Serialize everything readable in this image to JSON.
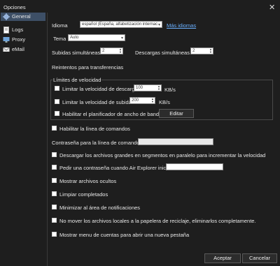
{
  "window": {
    "title": "Opciones",
    "close_icon": "close-icon"
  },
  "sidebar": {
    "items": [
      {
        "label": "General",
        "icon": "gear-icon",
        "selected": true
      },
      {
        "label": "Logs",
        "icon": "logs-icon"
      },
      {
        "label": "Proxy",
        "icon": "proxy-icon"
      },
      {
        "label": "eMail",
        "icon": "email-icon"
      }
    ]
  },
  "general": {
    "idioma_label": "Idioma",
    "idioma_value": "español (España, alfabetización internac",
    "mas_idiomas": "Más idiomas",
    "tema_label": "Tema",
    "tema_value": "Auto",
    "subidas_label": "Subidas simultáneas",
    "subidas_value": "2",
    "descargas_label": "Descargas simultáneas",
    "descargas_value": "2",
    "reintentos_label": "Reintentos para transferencias",
    "limites_title": "Límites de velocidad",
    "limitar_descarga_label": "Limitar la velocidad de descarga",
    "limitar_descarga_value": "100",
    "limitar_descarga_unit": "KB/s",
    "limitar_subida_label": "Limitar la velocidad de subida",
    "limitar_subida_value": "200",
    "limitar_subida_unit": "KB/s",
    "planificador_label": "Habilitar el planificador de ancho de banda",
    "editar_label": "Editar",
    "linea_comandos_label": "Habilitar la línea de comandos",
    "contrasena_linea_label": "Contraseña para la línea de comandos",
    "descargar_grandes_label": "Descargar los archivos grandes en segmentos en paralelo para incrementar la velocidad",
    "pedir_contrasena_label": "Pedir una contraseña cuando Air Explorer inicia",
    "mostrar_ocultos_label": "Mostrar archivos ocultos",
    "limpiar_label": "Limpiar completados",
    "minimizar_label": "Minimizar al área de notificaciones",
    "no_mover_label": "No mover los archivos locales a la papelera de reciclaje, eliminarlos completamente.",
    "mostrar_menu_label": "Mostrar menu de cuentas para abrir una nueva pestaña"
  },
  "footer": {
    "aceptar": "Aceptar",
    "cancelar": "Cancelar"
  }
}
